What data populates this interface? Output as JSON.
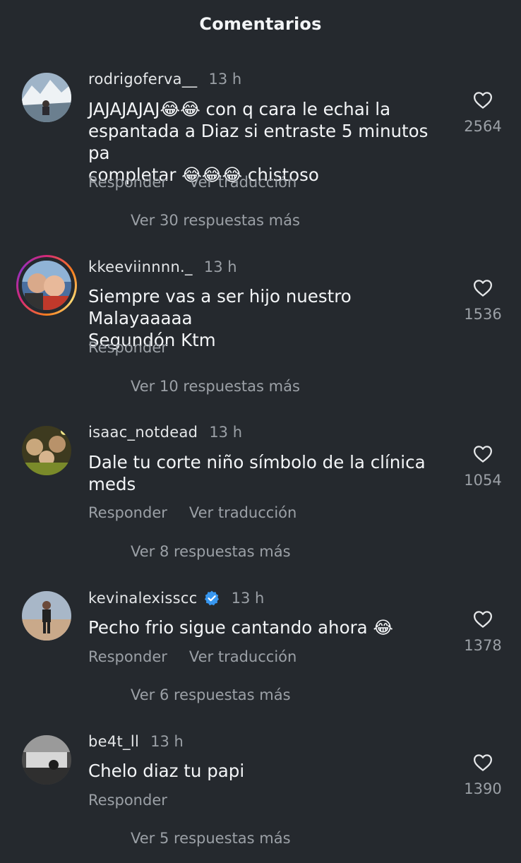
{
  "header": {
    "title": "Comentarios"
  },
  "comments": [
    {
      "username": "rodrigoferva__",
      "time": "13 h",
      "text_lines": [
        "JAJAJAJAJ😂😂 con q cara le echai la",
        "espantada a Diaz si entraste 5 minutos pa",
        "completar 😂😂😂 chistoso"
      ],
      "actions": {
        "reply": "Responder",
        "translate": "Ver traducción"
      },
      "replies_label": "Ver 30 respuestas más",
      "likes": "2564",
      "verified": false,
      "story_ring": false
    },
    {
      "username": "kkeeviinnnn._",
      "time": "13 h",
      "text_lines": [
        "Siempre vas a ser hijo nuestro Malayaaaaa",
        "Segundón Ktm"
      ],
      "actions": {
        "reply": "Responder"
      },
      "replies_label": "Ver 10 respuestas más",
      "likes": "1536",
      "verified": false,
      "story_ring": true
    },
    {
      "username": "isaac_notdead",
      "time": "13 h",
      "text_lines": [
        "Dale tu corte niño símbolo de la clínica",
        "meds"
      ],
      "actions": {
        "reply": "Responder",
        "translate": "Ver traducción"
      },
      "replies_label": "Ver 8 respuestas más",
      "likes": "1054",
      "verified": false,
      "story_ring": false
    },
    {
      "username": "kevinalexisscc",
      "time": "13 h",
      "text_lines": [
        "Pecho frio sigue cantando ahora 😂"
      ],
      "actions": {
        "reply": "Responder",
        "translate": "Ver traducción"
      },
      "replies_label": "Ver 6 respuestas más",
      "likes": "1378",
      "verified": true,
      "story_ring": false
    },
    {
      "username": "be4t_ll",
      "time": "13 h",
      "text_lines": [
        "Chelo diaz tu papi"
      ],
      "actions": {
        "reply": "Responder"
      },
      "replies_label": "Ver 5 respuestas más",
      "likes": "1390",
      "verified": false,
      "story_ring": false
    }
  ],
  "icons": {
    "like": "heart-outline-icon",
    "verified": "verified-badge-icon"
  },
  "colors": {
    "background": "#25292e",
    "text": "#f3f5f7",
    "muted": "#9ba0a6",
    "verified": "#3897f0"
  }
}
